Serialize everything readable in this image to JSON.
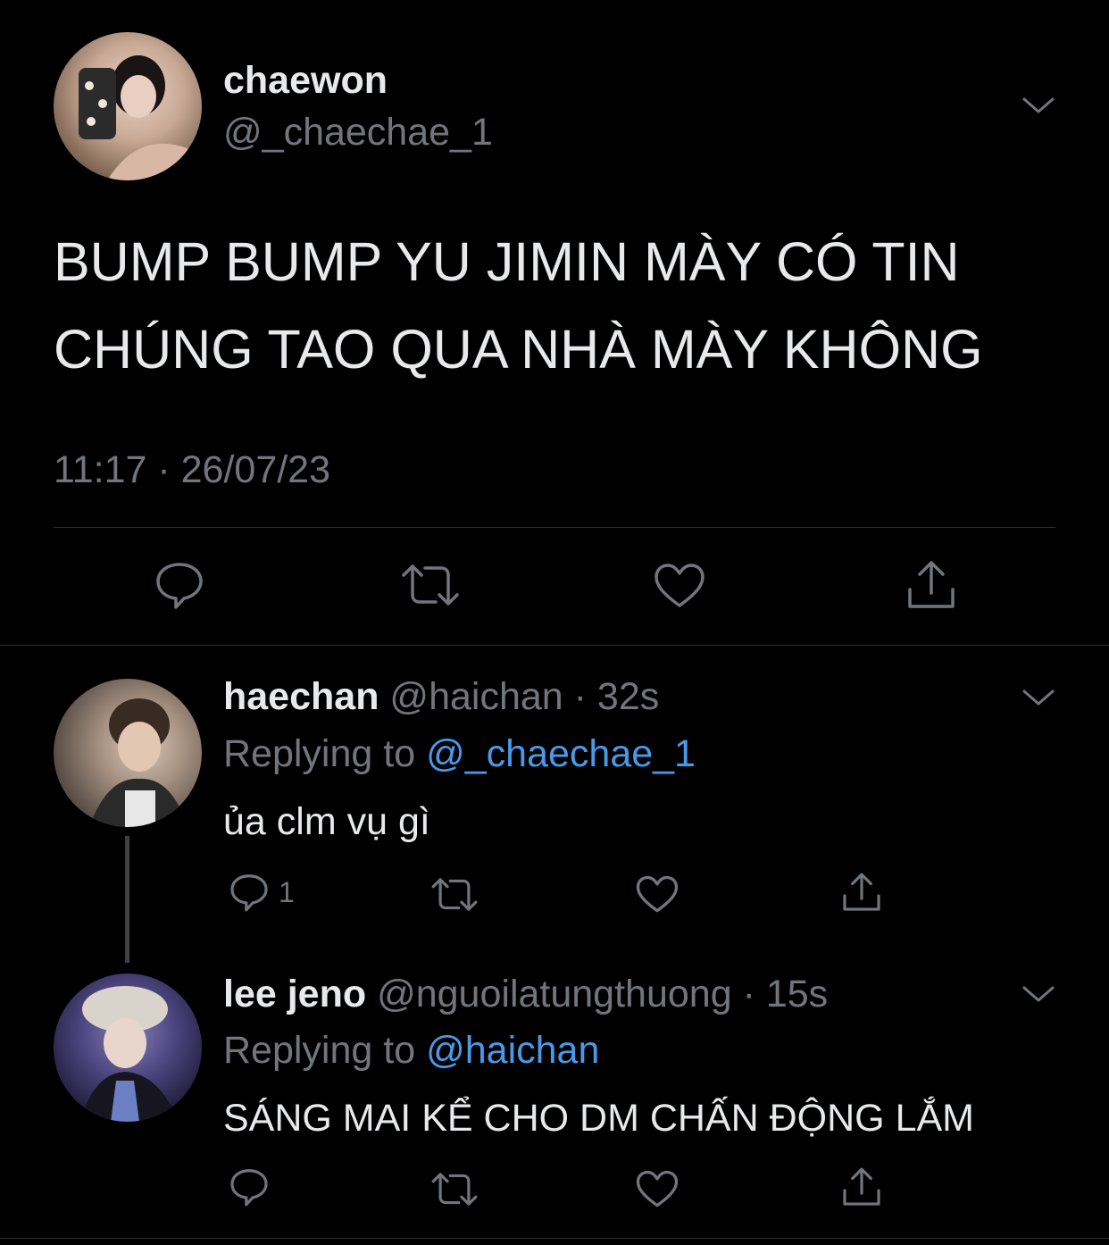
{
  "main_tweet": {
    "display_name": "chaewon",
    "handle": "@_chaechae_1",
    "text_line1": "BUMP BUMP YU JIMIN MÀY CÓ TIN",
    "text_line2": "CHÚNG TAO QUA NHÀ MÀY KHÔNG",
    "timestamp": "11:17 · 26/07/23"
  },
  "replies": [
    {
      "display_name": "haechan",
      "handle": "@haichan",
      "time": "· 32s",
      "replying_prefix": "Replying to",
      "replying_to": "@_chaechae_1",
      "text": "ủa clm vụ gì",
      "reply_count": "1"
    },
    {
      "display_name": "lee jeno",
      "handle": "@nguoilatungthuong",
      "time": "· 15s",
      "replying_prefix": "Replying to",
      "replying_to": "@haichan",
      "text": "SÁNG MAI KỂ CHO DM CHẤN ĐỘNG LẮM",
      "reply_count": ""
    }
  ],
  "icons": {
    "reply": "speech-bubble-icon",
    "retweet": "retweet-arrows-icon",
    "like": "heart-icon",
    "share": "share-upload-icon",
    "more": "chevron-down-icon"
  },
  "colors": {
    "background": "#000000",
    "text": "#e7e9ea",
    "muted": "#71767b",
    "link": "#4a99e9",
    "divider": "#2f3336"
  }
}
